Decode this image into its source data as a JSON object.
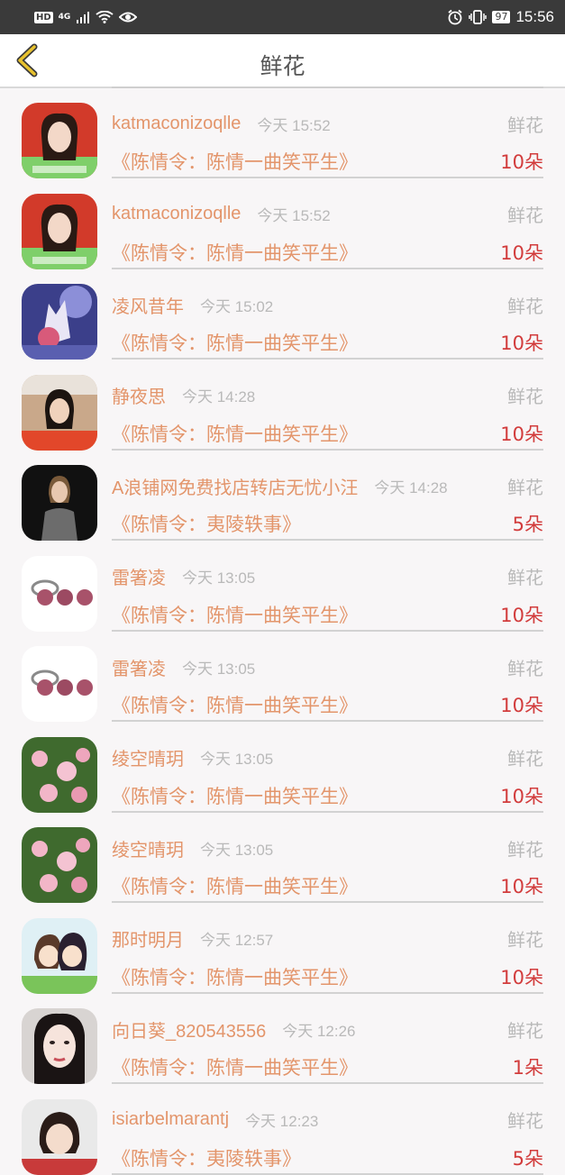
{
  "status_bar": {
    "hd": "HD",
    "network": "4G",
    "battery": "97",
    "time": "15:56"
  },
  "header": {
    "title": "鲜花",
    "back_icon": "chevron-left-icon",
    "back_color": "#e8c22e"
  },
  "colors": {
    "name": "#e3956b",
    "time": "#b9b9b9",
    "count": "#d23c3c"
  },
  "records": [
    {
      "name": "katmaconizoqlle",
      "time": "今天 15:52",
      "gift": "鲜花",
      "work": "《陈情令：陈情一曲笑平生》",
      "count": "10朵",
      "avatar": "avatar-woman-red-bg"
    },
    {
      "name": "katmaconizoqlle",
      "time": "今天 15:52",
      "gift": "鲜花",
      "work": "《陈情令：陈情一曲笑平生》",
      "count": "10朵",
      "avatar": "avatar-woman-red-bg"
    },
    {
      "name": "凌风昔年",
      "time": "今天 15:02",
      "gift": "鲜花",
      "work": "《陈情令：陈情一曲笑平生》",
      "count": "10朵",
      "avatar": "avatar-anime-fox"
    },
    {
      "name": "静夜思",
      "time": "今天 14:28",
      "gift": "鲜花",
      "work": "《陈情令：陈情一曲笑平生》",
      "count": "10朵",
      "avatar": "avatar-woman-banner"
    },
    {
      "name": "A浪铺网免费找店转店无忧小汪",
      "time": "今天 14:28",
      "gift": "鲜花",
      "work": "《陈情令：夷陵轶事》",
      "count": "5朵",
      "avatar": "avatar-woman-suit"
    },
    {
      "name": "雷箸凌",
      "time": "今天 13:05",
      "gift": "鲜花",
      "work": "《陈情令：陈情一曲笑平生》",
      "count": "10朵",
      "avatar": "avatar-pearl-ring"
    },
    {
      "name": "雷箸凌",
      "time": "今天 13:05",
      "gift": "鲜花",
      "work": "《陈情令：陈情一曲笑平生》",
      "count": "10朵",
      "avatar": "avatar-pearl-ring"
    },
    {
      "name": "绫空晴玥",
      "time": "今天 13:05",
      "gift": "鲜花",
      "work": "《陈情令：陈情一曲笑平生》",
      "count": "10朵",
      "avatar": "avatar-pink-flowers"
    },
    {
      "name": "绫空晴玥",
      "time": "今天 13:05",
      "gift": "鲜花",
      "work": "《陈情令：陈情一曲笑平生》",
      "count": "10朵",
      "avatar": "avatar-pink-flowers"
    },
    {
      "name": "那时明月",
      "time": "今天 12:57",
      "gift": "鲜花",
      "work": "《陈情令：陈情一曲笑平生》",
      "count": "10朵",
      "avatar": "avatar-chibi-couple"
    },
    {
      "name": "向日葵_820543556",
      "time": "今天 12:26",
      "gift": "鲜花",
      "work": "《陈情令：陈情一曲笑平生》",
      "count": "1朵",
      "avatar": "avatar-woman-portrait"
    },
    {
      "name": "isiarbelmarantj",
      "time": "今天 12:23",
      "gift": "鲜花",
      "work": "《陈情令：夷陵轶事》",
      "count": "5朵",
      "avatar": "avatar-child"
    }
  ]
}
